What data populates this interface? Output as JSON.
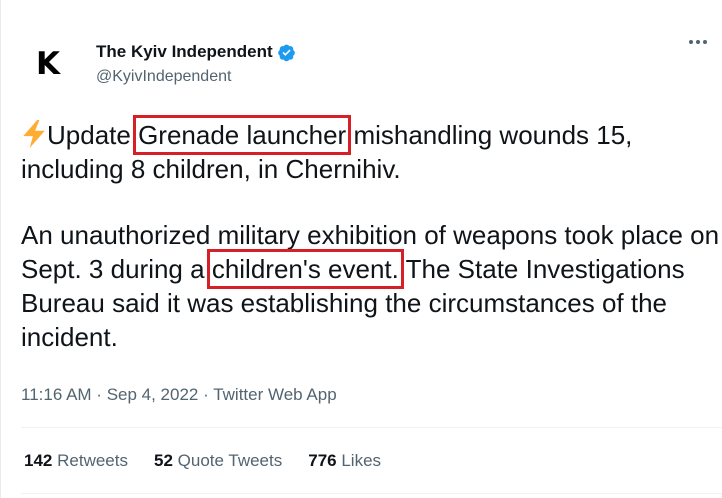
{
  "author": {
    "avatar_letter": "K",
    "display_name": "The Kyiv Independent",
    "handle": "@KyivIndependent",
    "verified_icon": "verified-badge-icon",
    "verified_color": "#1d9bf0"
  },
  "tweet": {
    "paragraph1": {
      "bolt_icon": "lightning-bolt-icon",
      "prefix": "Update:",
      "highlight": "Grenade launcher",
      "suffix": " mishandling wounds 15, including 8 children, in Chernihiv."
    },
    "paragraph2": {
      "prefix": "An unauthorized military exhibition of weapons took place on Sept. 3 during a ",
      "highlight": "children's event.",
      "suffix": " The State Investigations Bureau said it was establishing the circumstances of the incident."
    },
    "highlight_color": "#d62027"
  },
  "meta": {
    "time": "11:16 AM",
    "separator": " · ",
    "date": "Sep 4, 2022",
    "source": "Twitter Web App"
  },
  "stats": {
    "retweets_count": "142",
    "retweets_label": "Retweets",
    "quotes_count": "52",
    "quotes_label": "Quote Tweets",
    "likes_count": "776",
    "likes_label": "Likes"
  }
}
